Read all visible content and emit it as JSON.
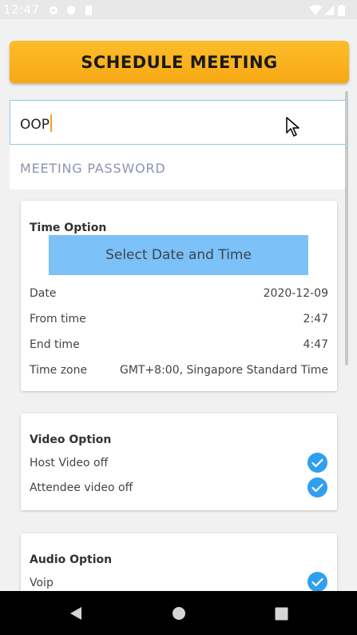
{
  "status_bar": {
    "time": "12:47",
    "icons_left": [
      "gear-icon",
      "shield-icon",
      "sd-card-icon"
    ],
    "icons_right": [
      "wifi-icon",
      "signal-icon",
      "battery-icon"
    ]
  },
  "header": {
    "schedule_label": "SCHEDULE MEETING"
  },
  "form": {
    "topic_value": "OOP",
    "password_placeholder": "MEETING PASSWORD"
  },
  "time_option": {
    "title": "Time Option",
    "select_label": "Select Date and Time",
    "rows": [
      {
        "label": "Date",
        "value": "2020-12-09"
      },
      {
        "label": "From time",
        "value": "2:47"
      },
      {
        "label": "End time",
        "value": "4:47"
      },
      {
        "label": "Time zone",
        "value": "GMT+8:00, Singapore Standard Time"
      }
    ]
  },
  "video_option": {
    "title": "Video Option",
    "items": [
      {
        "label": "Host Video off",
        "checked": true
      },
      {
        "label": "Attendee video off",
        "checked": true
      }
    ]
  },
  "audio_option": {
    "title": "Audio Option",
    "items": [
      {
        "label": "Voip",
        "checked": true
      }
    ]
  },
  "colors": {
    "accent_orange": "#f7a814",
    "select_blue": "#7cc1f7",
    "check_blue": "#2f9ff0"
  }
}
